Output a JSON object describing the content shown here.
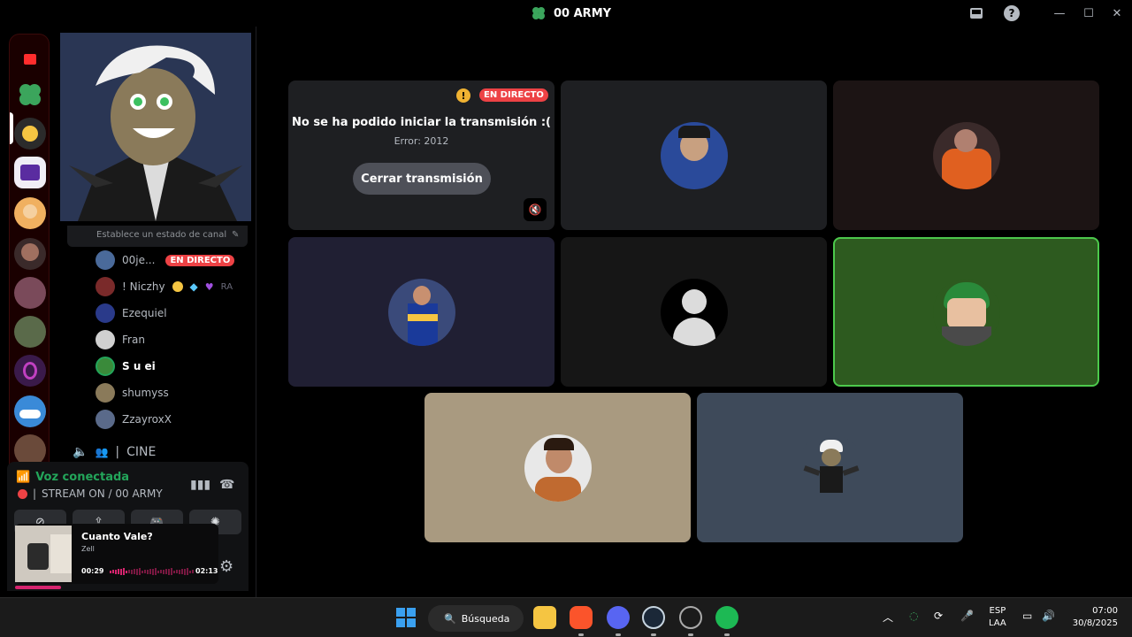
{
  "window": {
    "title": "00 ARMY"
  },
  "sidebar": {
    "status_prompt": "Establece un estado de canal",
    "members": [
      {
        "name": "00je...",
        "live": "EN DIRECTO"
      },
      {
        "name": "! Niczhy",
        "extra": "RA"
      },
      {
        "name": "Ezequiel"
      },
      {
        "name": "Fran"
      },
      {
        "name": "S u ei"
      },
      {
        "name": "shumyss"
      },
      {
        "name": "ZzayroxX"
      }
    ],
    "next_channel": "CINE"
  },
  "voice": {
    "status": "Voz conectada",
    "channel": "STREAM ON / 00 ARMY"
  },
  "music": {
    "title": "Cuanto Vale?",
    "artist": "Zell",
    "elapsed": "00:29",
    "total": "02:13",
    "progress": 0.22,
    "partial_name": "yroxX"
  },
  "stage": {
    "stream_error": {
      "badge": "EN DIRECTO",
      "title": "No se ha podido iniciar la transmisión :(",
      "error": "Error: 2012",
      "button": "Cerrar transmisión"
    }
  },
  "taskbar": {
    "search": "Búsqueda",
    "lang_top": "ESP",
    "lang_bottom": "LAA",
    "time": "07:00",
    "date": "30/8/2025"
  },
  "colors": {
    "live_red": "#ed4245",
    "voice_green": "#23a55a",
    "speaking_tile": "#2d5a1f",
    "speaking_border": "#4cc94c",
    "music_pink": "#d6246e"
  }
}
